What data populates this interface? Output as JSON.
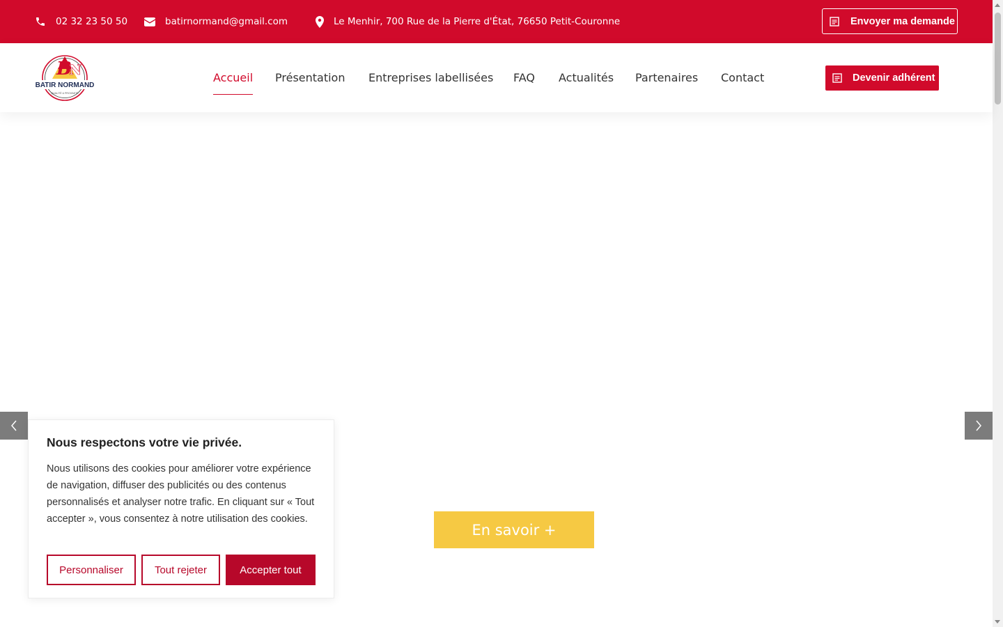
{
  "topbar": {
    "phone": "02 32 23 50 50",
    "email": "batirnormand@gmail.com",
    "address": "Le Menhir, 700 Rue de la Pierre d'État, 76650 Petit-Couronne",
    "request_button": "Envoyer ma demande",
    "icons": {
      "phone": "phone-icon",
      "email": "envelope-icon",
      "address": "map-pin-icon",
      "request": "form-icon"
    }
  },
  "header": {
    "logo_text": "BATIR NORMAND",
    "logo_tagline": "QUALITÉ & PROXIMITÉ",
    "nav": [
      "Accueil",
      "Présentation",
      "Entreprises labellisées",
      "FAQ",
      "Actualités",
      "Partenaires",
      "Contact"
    ],
    "active_nav": "Accueil",
    "join_button": "Devenir adhérent"
  },
  "hero": {
    "cta_label": "En savoir +",
    "prev_icon": "chevron-left-icon",
    "next_icon": "chevron-right-icon"
  },
  "cookie_banner": {
    "title": "Nous respectons votre vie privée.",
    "body": "Nous utilisons des cookies pour améliorer votre expérience de navigation, diffuser des publicités ou des contenus personnalisés et analyser notre trafic. En cliquant sur « Tout accepter », vous consentez à notre utilisation des cookies.",
    "buttons": [
      "Personnaliser",
      "Tout rejeter",
      "Accepter tout"
    ]
  },
  "colors": {
    "brand_red": "#d10a2b",
    "cookie_red": "#b7082a",
    "cta_yellow": "#f6c943",
    "arrow_gray": "#7c7c7c"
  }
}
